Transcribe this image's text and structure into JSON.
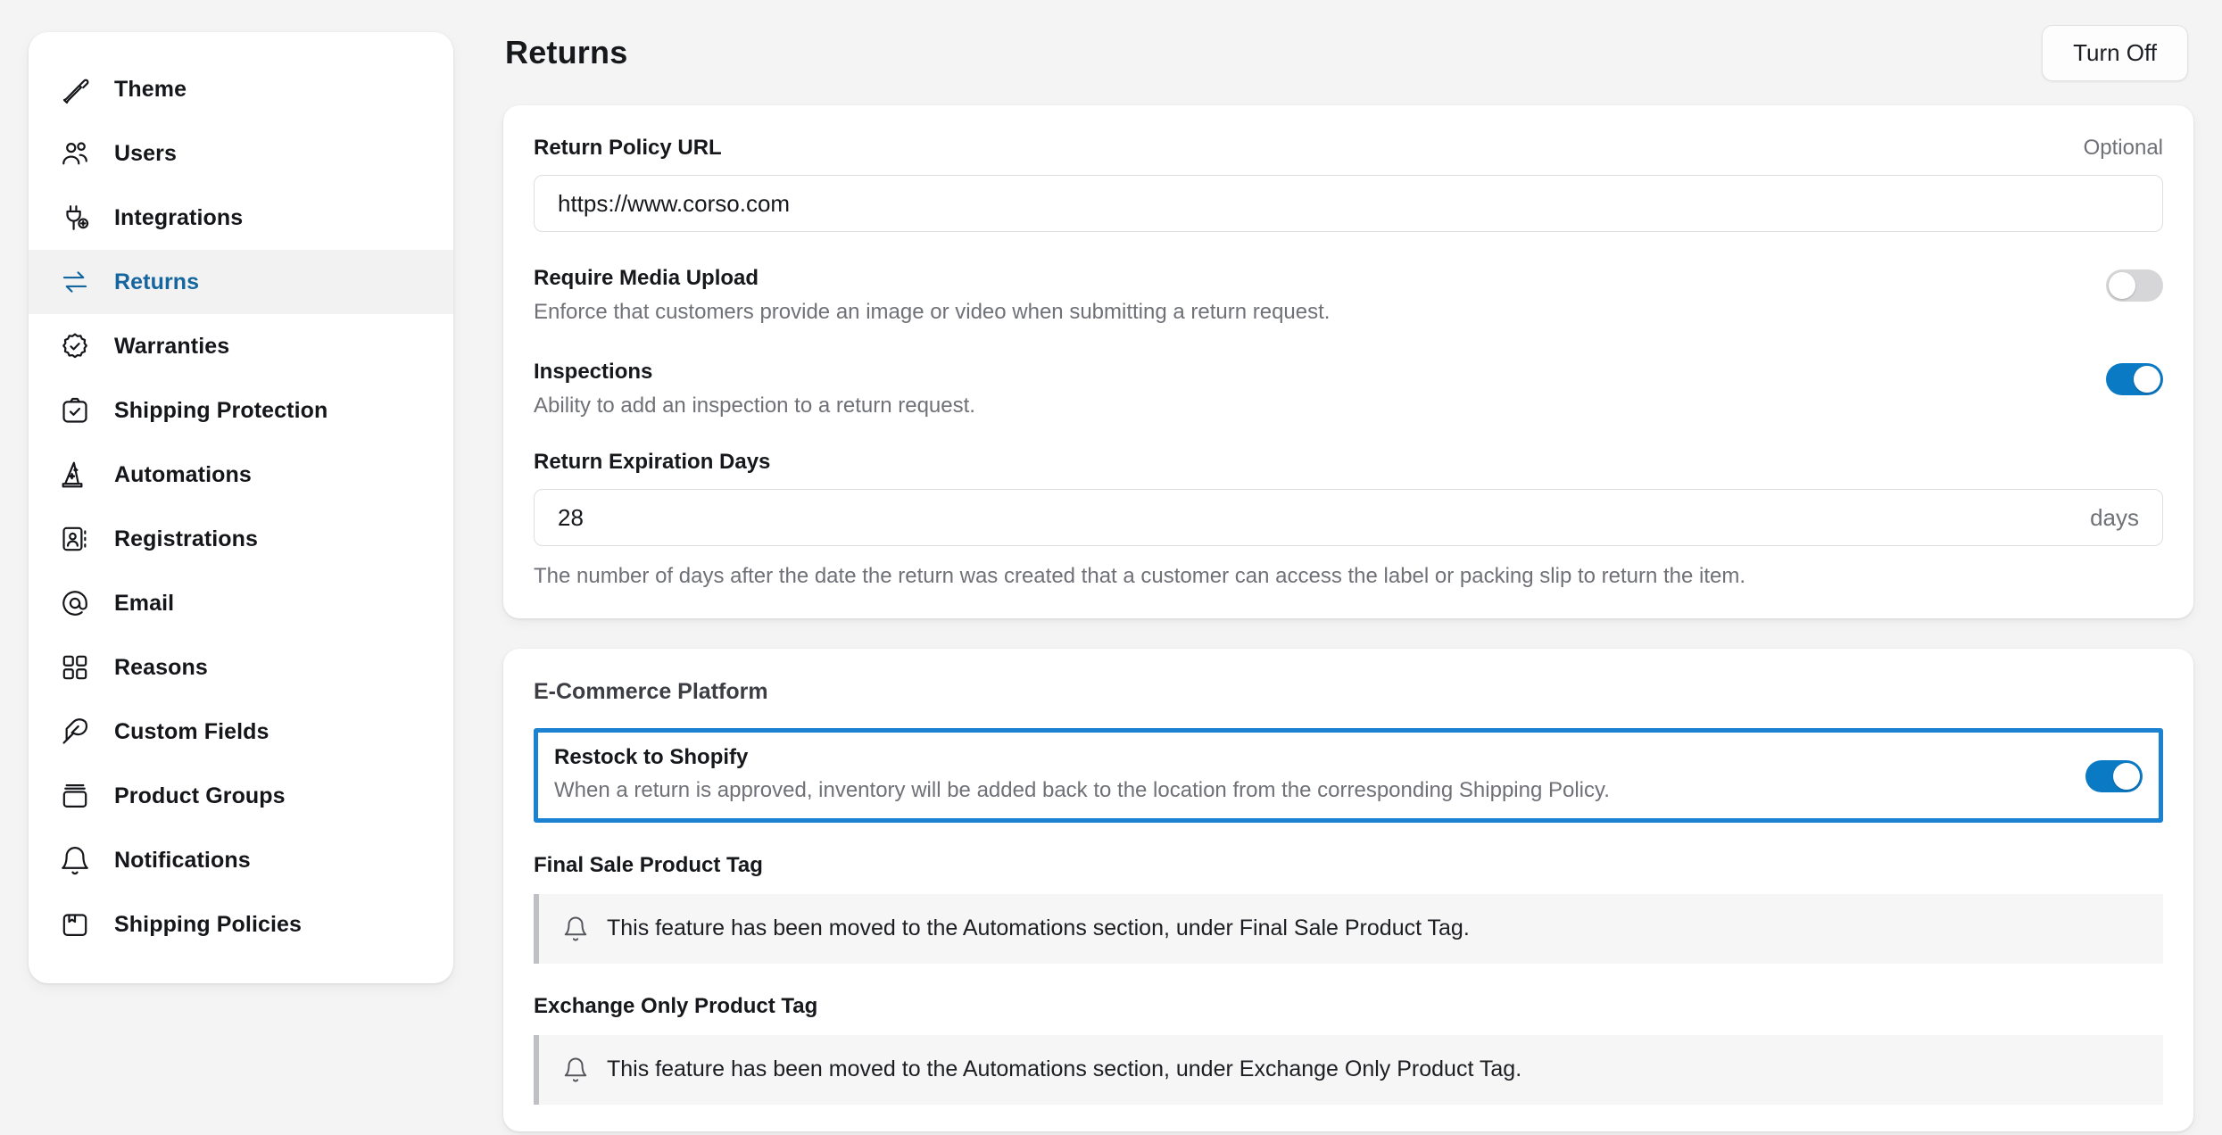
{
  "sidebar": {
    "items": [
      {
        "label": "Theme",
        "icon": "brush-icon",
        "active": false
      },
      {
        "label": "Users",
        "icon": "users-icon",
        "active": false
      },
      {
        "label": "Integrations",
        "icon": "plug-plus-icon",
        "active": false
      },
      {
        "label": "Returns",
        "icon": "arrows-exchange-icon",
        "active": true
      },
      {
        "label": "Warranties",
        "icon": "badge-check-icon",
        "active": false
      },
      {
        "label": "Shipping Protection",
        "icon": "box-check-icon",
        "active": false
      },
      {
        "label": "Automations",
        "icon": "wizard-hat-icon",
        "active": false
      },
      {
        "label": "Registrations",
        "icon": "id-card-icon",
        "active": false
      },
      {
        "label": "Email",
        "icon": "at-sign-icon",
        "active": false
      },
      {
        "label": "Reasons",
        "icon": "grid-squares-icon",
        "active": false
      },
      {
        "label": "Custom Fields",
        "icon": "feather-icon",
        "active": false
      },
      {
        "label": "Product Groups",
        "icon": "stacked-box-icon",
        "active": false
      },
      {
        "label": "Notifications",
        "icon": "bell-icon",
        "active": false
      },
      {
        "label": "Shipping Policies",
        "icon": "package-icon",
        "active": false
      }
    ]
  },
  "header": {
    "title": "Returns",
    "turn_off_label": "Turn Off"
  },
  "settings_card": {
    "return_policy_url": {
      "label": "Return Policy URL",
      "optional_label": "Optional",
      "value": "https://www.corso.com",
      "placeholder": "https://www.corso.com"
    },
    "require_media_upload": {
      "title": "Require Media Upload",
      "description": "Enforce that customers provide an image or video when submitting a return request.",
      "enabled": false
    },
    "inspections": {
      "title": "Inspections",
      "description": "Ability to add an inspection to a return request.",
      "enabled": true
    },
    "return_expiration_days": {
      "label": "Return Expiration Days",
      "value": "28",
      "suffix": "days",
      "help": "The number of days after the date the return was created that a customer can access the label or packing slip to return the item."
    }
  },
  "platform_card": {
    "section_title": "E-Commerce Platform",
    "restock_to_shopify": {
      "title": "Restock to Shopify",
      "description": "When a return is approved, inventory will be added back to the location from the corresponding Shipping Policy.",
      "enabled": true,
      "highlighted": true
    },
    "final_sale_product_tag": {
      "label": "Final Sale Product Tag",
      "callout": "This feature has been moved to the Automations section, under Final Sale Product Tag."
    },
    "exchange_only_product_tag": {
      "label": "Exchange Only Product Tag",
      "callout": "This feature has been moved to the Automations section, under Exchange Only Product Tag."
    }
  },
  "colors": {
    "accent_blue": "#0b7ac4",
    "active_nav_blue": "#15659f",
    "highlight_border": "#1a82d0",
    "page_background": "#f4f4f4",
    "toggle_off": "#d6d6d8"
  }
}
